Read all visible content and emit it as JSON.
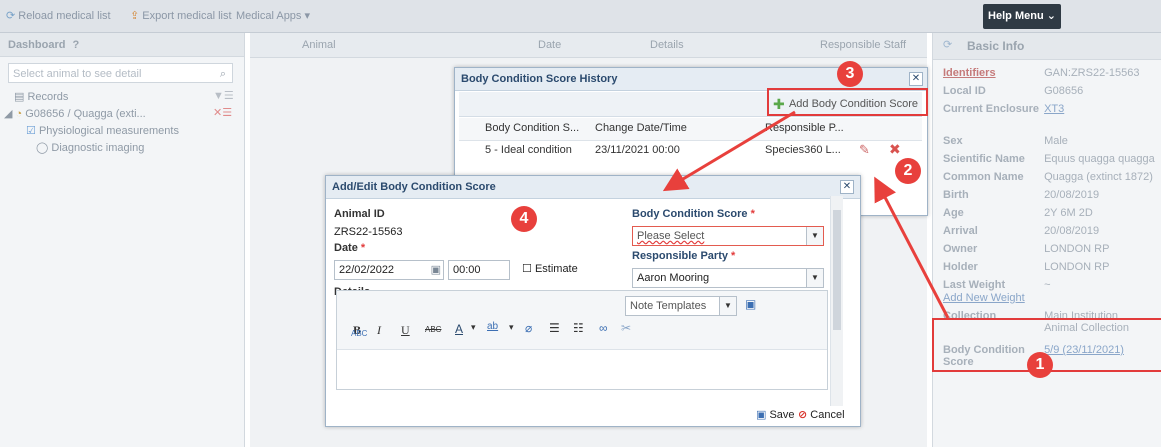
{
  "toolbar": {
    "reload": "Reload medical list",
    "export": "Export medical list",
    "apps": "Medical Apps ▾",
    "help_menu": "Help Menu"
  },
  "dashboard": {
    "title": "Dashboard",
    "search_placeholder": "Select animal to see detail",
    "tree": {
      "records": "Records",
      "animal": "G08656 / Quagga (exti...",
      "physiological": "Physiological measurements",
      "diagnostic": "Diagnostic imaging"
    }
  },
  "grid": {
    "columns": [
      "Animal",
      "Date",
      "Details",
      "Responsible Staff"
    ]
  },
  "basic_info": {
    "title": "Basic Info",
    "rows": [
      {
        "label": "Identifiers",
        "value": "GAN:ZRS22-15563"
      },
      {
        "label": "Local ID",
        "value": "G08656"
      },
      {
        "label": "Current Enclosure",
        "value": "XT3"
      },
      {
        "label": "Sex",
        "value": "Male"
      },
      {
        "label": "Scientific Name",
        "value": "Equus quagga quagga"
      },
      {
        "label": "Common Name",
        "value": "Quagga (extinct 1872)"
      },
      {
        "label": "Birth",
        "value": "20/08/2019"
      },
      {
        "label": "Age",
        "value": "2Y 6M 2D"
      },
      {
        "label": "Arrival",
        "value": "20/08/2019"
      },
      {
        "label": "Owner",
        "value": "LONDON RP"
      },
      {
        "label": "Holder",
        "value": "LONDON RP"
      },
      {
        "label": "Last Weight",
        "value": "~"
      },
      {
        "label": "Add New Weight",
        "value": ""
      },
      {
        "label": "Collection",
        "value": "Main Institution Animal Collection"
      },
      {
        "label": "Body Condition Score",
        "value": "5/9 (23/11/2021)"
      }
    ]
  },
  "history": {
    "title": "Body Condition Score History",
    "add_button": "Add Body Condition Score",
    "columns": [
      "Body Condition S...",
      "Change Date/Time",
      "Responsible P..."
    ],
    "rows": [
      {
        "score": "5 - Ideal condition",
        "date": "23/11/2021 00:00",
        "party": "Species360 L..."
      }
    ]
  },
  "dialog": {
    "title": "Add/Edit Body Condition Score",
    "animal_id_label": "Animal ID",
    "animal_id": "ZRS22-15563",
    "date_label": "Date",
    "date_value": "22/02/2022",
    "time_value": "00:00",
    "estimate_label": "Estimate",
    "details_label": "Details",
    "bcs_label": "Body Condition Score",
    "bcs_placeholder": "Please Select",
    "party_label": "Responsible Party",
    "party_value": "Aaron Mooring",
    "note_templates": "Note Templates",
    "save": "Save",
    "cancel": "Cancel",
    "rte": {
      "bold": "B",
      "italic": "I",
      "underline": "U",
      "strike": "ABC",
      "font_color": "A",
      "highlight": "ab",
      "eraser": "⌀",
      "ul": "☰",
      "ol": "☷",
      "link": "∞",
      "unlink": "✂",
      "spell": "ABC"
    }
  },
  "required_marker": "*",
  "markers": [
    "1",
    "2",
    "3",
    "4"
  ],
  "colors": {
    "marker_red": "#e8403c",
    "title_blue": "#2b4a6e"
  }
}
